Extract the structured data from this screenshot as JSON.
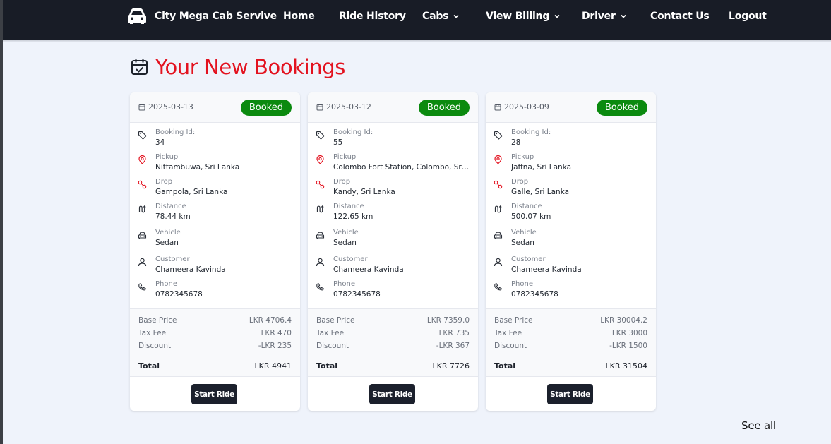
{
  "nav": {
    "brand": "City Mega Cab Servive",
    "links": [
      "Home",
      "Ride History",
      "Cabs",
      "View Billing",
      "Driver",
      "Contact Us",
      "Logout"
    ]
  },
  "page": {
    "title": "Your New Bookings",
    "see_all": "See all"
  },
  "labels": {
    "booking_id": "Booking Id:",
    "pickup": "Pickup",
    "drop": "Drop",
    "distance": "Distance",
    "vehicle": "Vehicle",
    "customer": "Customer",
    "phone": "Phone",
    "base_price": "Base Price",
    "tax_fee": "Tax Fee",
    "discount": "Discount",
    "total": "Total",
    "start_ride": "Start Ride"
  },
  "bookings": [
    {
      "date": "2025-03-13",
      "status": "Booked",
      "booking_id": "34",
      "pickup": "Nittambuwa, Sri Lanka",
      "drop": "Gampola, Sri Lanka",
      "distance": "78.44 km",
      "vehicle": "Sedan",
      "customer": "Chameera Kavinda",
      "phone": "0782345678",
      "base_price": "LKR 4706.4",
      "tax_fee": "LKR 470",
      "discount": "-LKR 235",
      "total": "LKR 4941"
    },
    {
      "date": "2025-03-12",
      "status": "Booked",
      "booking_id": "55",
      "pickup": "Colombo Fort Station, Colombo, Sri ...",
      "drop": "Kandy, Sri Lanka",
      "distance": "122.65 km",
      "vehicle": "Sedan",
      "customer": "Chameera Kavinda",
      "phone": "0782345678",
      "base_price": "LKR 7359.0",
      "tax_fee": "LKR 735",
      "discount": "-LKR 367",
      "total": "LKR 7726"
    },
    {
      "date": "2025-03-09",
      "status": "Booked",
      "booking_id": "28",
      "pickup": "Jaffna, Sri Lanka",
      "drop": "Galle, Sri Lanka",
      "distance": "500.07 km",
      "vehicle": "Sedan",
      "customer": "Chameera Kavinda",
      "phone": "0782345678",
      "base_price": "LKR 30004.2",
      "tax_fee": "LKR 3000",
      "discount": "-LKR 1500",
      "total": "LKR 31504"
    }
  ],
  "colors": {
    "nav_bg": "#181c26",
    "page_bg": "#eff3fb",
    "title": "#e3121f",
    "status_badge": "#0b8a0f",
    "location_icon": "#e3121f",
    "button": "#1b202c"
  },
  "icons": {
    "brand": "car-icon",
    "title": "calendar-check-icon",
    "date": "calendar-icon",
    "booking_id": "tag-icon",
    "pickup": "map-pin-icon",
    "drop": "route-pin-icon",
    "distance": "route-icon",
    "vehicle": "car-icon",
    "customer": "user-icon",
    "phone": "phone-icon",
    "dropdown": "chevron-down-icon"
  }
}
